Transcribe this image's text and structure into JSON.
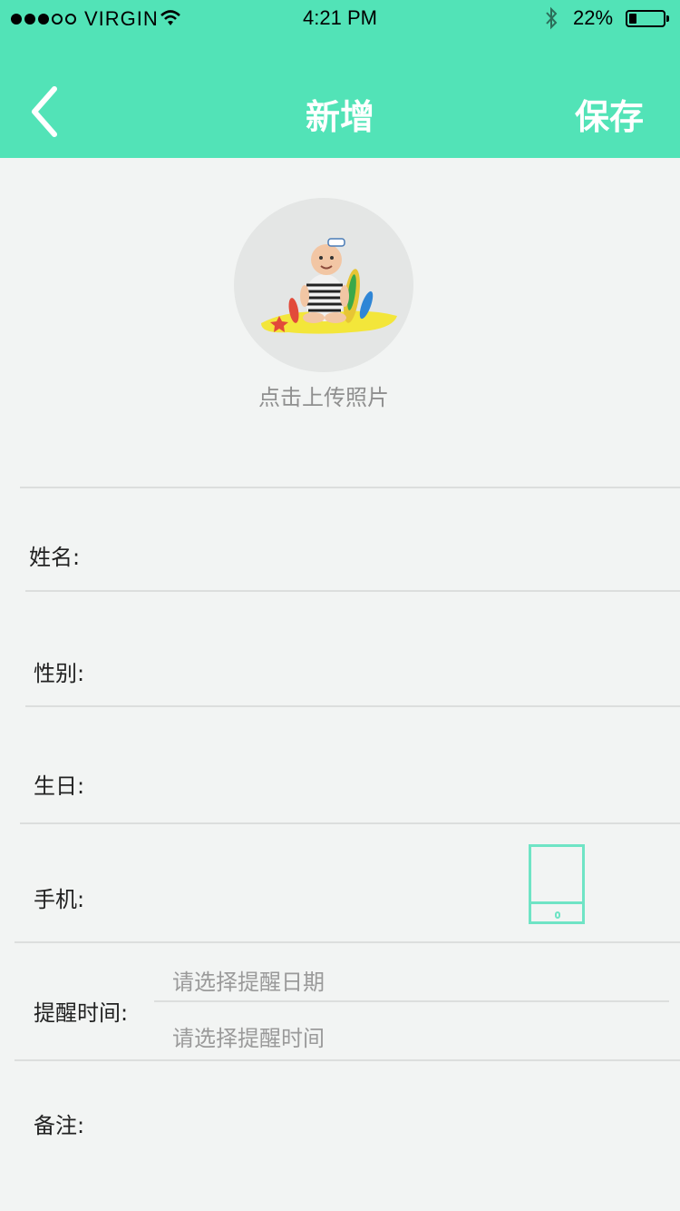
{
  "status_bar": {
    "carrier": "VIRGIN",
    "time": "4:21 PM",
    "battery_percent": "22%",
    "battery_level": 0.22
  },
  "nav": {
    "title": "新增",
    "save_label": "保存",
    "back_icon": "chevron-left-icon"
  },
  "avatar": {
    "upload_hint": "点击上传照片"
  },
  "form": {
    "name_label": "姓名:",
    "gender_label": "性别:",
    "birthday_label": "生日:",
    "phone_label": "手机:",
    "reminder_label": "提醒时间:",
    "reminder_date_placeholder": "请选择提醒日期",
    "reminder_time_placeholder": "请选择提醒时间",
    "notes_label": "备注:",
    "contact_icon": "phone-contacts-icon"
  },
  "colors": {
    "accent": "#52e3b7",
    "icon_outline": "#6fe4c5",
    "background": "#f2f4f3"
  }
}
